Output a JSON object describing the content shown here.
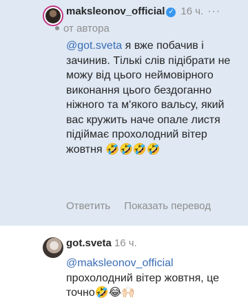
{
  "comments": [
    {
      "username": "maksleonov_official",
      "verified": true,
      "time": "16 ч.",
      "more": "···",
      "author_note": "от автора",
      "mention": "@got.sveta",
      "text": "я вже побачив і зачинив. Тількі слів підібрати не можу від цього неймовірного виконання цього бездоганно ніжного та м'якого вальсу, який вас кружить наче опале листя підіймає прохолодний вітер жовтня 🤣🤣🤣🤣",
      "actions": {
        "reply": "Ответить",
        "translate": "Показать перевод"
      }
    },
    {
      "username": "got.sveta",
      "time": "16 ч.",
      "mention": "@maksleonov_official",
      "text": "прохолодний вітер жовтня, це точно🤣😂🙌🏻"
    }
  ]
}
